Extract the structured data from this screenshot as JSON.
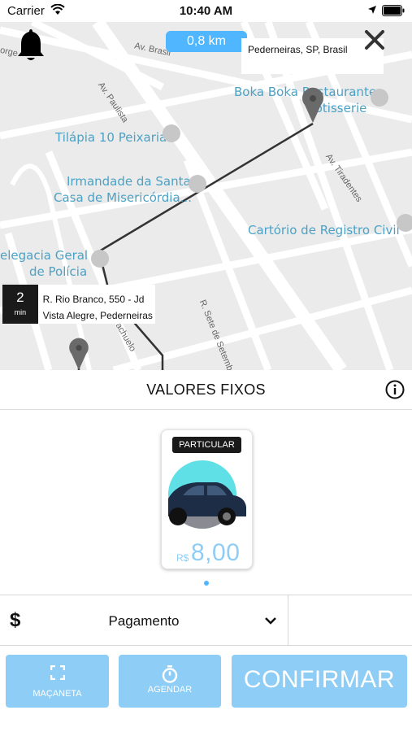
{
  "status_bar": {
    "carrier": "Carrier",
    "time": "10:40 AM"
  },
  "map": {
    "distance": "0,8 km",
    "destination_address": "Pederneiras, SP, Brasil",
    "origin": {
      "eta_value": "2",
      "eta_unit": "min",
      "address_line1": "R. Rio Branco, 550 - Jd",
      "address_line2": "Vista Alegre, Pederneiras -"
    },
    "places": [
      "Boka Boka Restaurante",
      "Rotisserie",
      "Tilápia 10 Peixaria",
      "Irmandade da Santa",
      "Casa de Misericórdia...",
      "Cartório de Registro Civil",
      "elegacia Geral",
      "de Polícia"
    ],
    "streets": [
      "Av. Paulista",
      "Av. Brasil",
      "Av. Tiradentes",
      "R. Sete de Setembro",
      "achuelo",
      "orge"
    ]
  },
  "fare": {
    "title": "VALORES FIXOS",
    "category": "PARTICULAR",
    "currency": "R$",
    "price": "8,00"
  },
  "payment": {
    "symbol": "$",
    "label": "Pagamento"
  },
  "actions": {
    "handle_label": "MAÇANETA",
    "schedule_label": "AGENDAR",
    "confirm_label": "CONFIRMAR"
  },
  "colors": {
    "accent": "#4fb6ff",
    "button_fill": "#8ecdf5",
    "map_background": "#ebebeb",
    "route": "#333333"
  }
}
